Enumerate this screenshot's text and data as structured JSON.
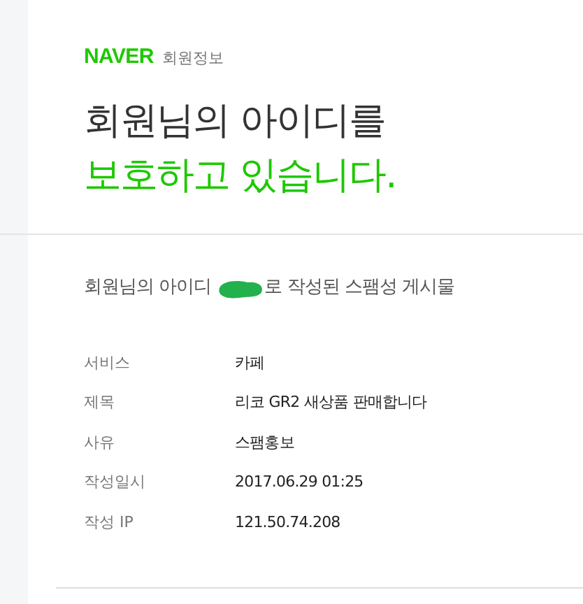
{
  "header": {
    "logo": "NAVER",
    "section": "회원정보"
  },
  "title": {
    "line_1": "회원님의 아이디를",
    "line_2": "보호하고 있습니다."
  },
  "notice": {
    "before": "회원님의 아이디",
    "id_redacted": true,
    "after": "로 작성된 스팸성 게시물"
  },
  "details": [
    {
      "label": "서비스",
      "value": "카페"
    },
    {
      "label": "제목",
      "value": "리코 GR2 새상품 판매합니다"
    },
    {
      "label": "사유",
      "value": "스팸홍보"
    },
    {
      "label": "작성일시",
      "value": "2017.06.29 01:25"
    },
    {
      "label": "작성 IP",
      "value": "121.50.74.208"
    }
  ]
}
